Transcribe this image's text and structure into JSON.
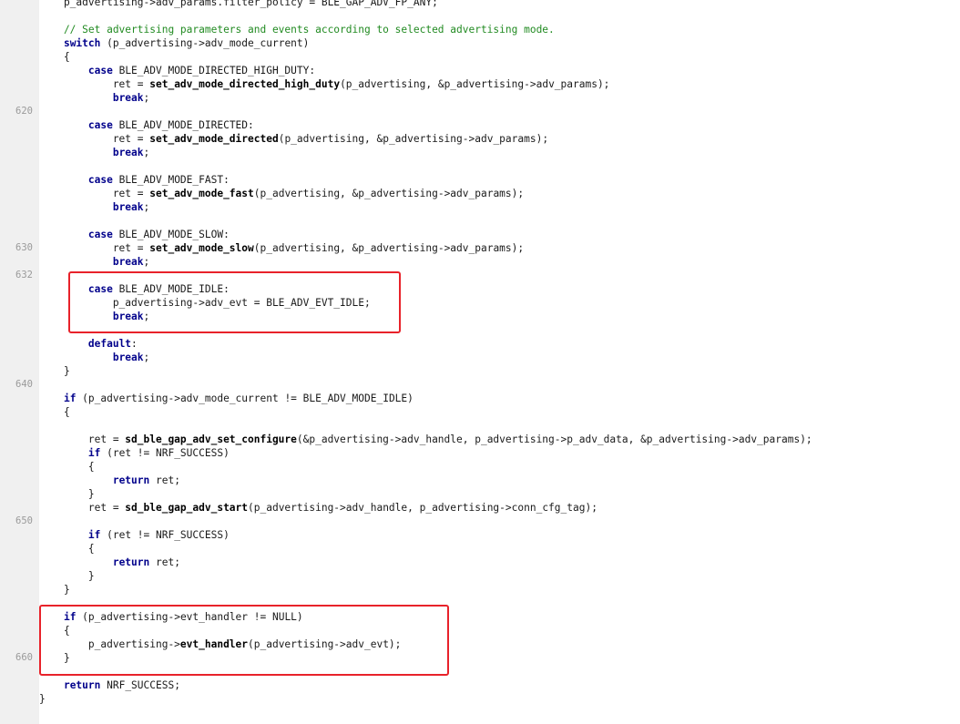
{
  "highlight_color": "#e8222a",
  "colors": {
    "keyword": "#00008b",
    "comment": "#228b22",
    "line_number": "#9a9a9a",
    "gutter": "#f0f0f0"
  },
  "line_numbers": [
    {
      "label": "620",
      "row": 8
    },
    {
      "label": "630",
      "row": 18
    },
    {
      "label": "632",
      "row": 20
    },
    {
      "label": "640",
      "row": 28
    },
    {
      "label": "650",
      "row": 38
    },
    {
      "label": "660",
      "row": 48
    }
  ],
  "lines": [
    [
      {
        "t": "    p_advertising->adv_params.filter_policy = BLE_GAP_ADV_FP_ANY;",
        "k": "tx"
      }
    ],
    [],
    [
      {
        "t": "    // Set advertising parameters and events according to selected advertising mode.",
        "k": "cm"
      }
    ],
    [
      {
        "t": "    ",
        "k": "tx"
      },
      {
        "t": "switch",
        "k": "kw"
      },
      {
        "t": " (p_advertising->adv_mode_current)",
        "k": "tx"
      }
    ],
    [
      {
        "t": "    {",
        "k": "tx"
      }
    ],
    [
      {
        "t": "        ",
        "k": "tx"
      },
      {
        "t": "case",
        "k": "kw"
      },
      {
        "t": " BLE_ADV_MODE_DIRECTED_HIGH_DUTY:",
        "k": "tx"
      }
    ],
    [
      {
        "t": "            ret = ",
        "k": "tx"
      },
      {
        "t": "set_adv_mode_directed_high_duty",
        "k": "fn"
      },
      {
        "t": "(p_advertising, &p_advertising->adv_params);",
        "k": "tx"
      }
    ],
    [
      {
        "t": "            ",
        "k": "tx"
      },
      {
        "t": "break",
        "k": "kw"
      },
      {
        "t": ";",
        "k": "tx"
      }
    ],
    [],
    [
      {
        "t": "        ",
        "k": "tx"
      },
      {
        "t": "case",
        "k": "kw"
      },
      {
        "t": " BLE_ADV_MODE_DIRECTED:",
        "k": "tx"
      }
    ],
    [
      {
        "t": "            ret = ",
        "k": "tx"
      },
      {
        "t": "set_adv_mode_directed",
        "k": "fn"
      },
      {
        "t": "(p_advertising, &p_advertising->adv_params);",
        "k": "tx"
      }
    ],
    [
      {
        "t": "            ",
        "k": "tx"
      },
      {
        "t": "break",
        "k": "kw"
      },
      {
        "t": ";",
        "k": "tx"
      }
    ],
    [],
    [
      {
        "t": "        ",
        "k": "tx"
      },
      {
        "t": "case",
        "k": "kw"
      },
      {
        "t": " BLE_ADV_MODE_FAST:",
        "k": "tx"
      }
    ],
    [
      {
        "t": "            ret = ",
        "k": "tx"
      },
      {
        "t": "set_adv_mode_fast",
        "k": "fn"
      },
      {
        "t": "(p_advertising, &p_advertising->adv_params);",
        "k": "tx"
      }
    ],
    [
      {
        "t": "            ",
        "k": "tx"
      },
      {
        "t": "break",
        "k": "kw"
      },
      {
        "t": ";",
        "k": "tx"
      }
    ],
    [],
    [
      {
        "t": "        ",
        "k": "tx"
      },
      {
        "t": "case",
        "k": "kw"
      },
      {
        "t": " BLE_ADV_MODE_SLOW:",
        "k": "tx"
      }
    ],
    [
      {
        "t": "            ret = ",
        "k": "tx"
      },
      {
        "t": "set_adv_mode_slow",
        "k": "fn"
      },
      {
        "t": "(p_advertising, &p_advertising->adv_params);",
        "k": "tx"
      }
    ],
    [
      {
        "t": "            ",
        "k": "tx"
      },
      {
        "t": "break",
        "k": "kw"
      },
      {
        "t": ";",
        "k": "tx"
      }
    ],
    [],
    [
      {
        "t": "        ",
        "k": "tx"
      },
      {
        "t": "case",
        "k": "kw"
      },
      {
        "t": " BLE_ADV_MODE_IDLE:",
        "k": "tx"
      }
    ],
    [
      {
        "t": "            p_advertising->adv_evt = BLE_ADV_EVT_IDLE;",
        "k": "tx"
      }
    ],
    [
      {
        "t": "            ",
        "k": "tx"
      },
      {
        "t": "break",
        "k": "kw"
      },
      {
        "t": ";",
        "k": "tx"
      }
    ],
    [],
    [
      {
        "t": "        ",
        "k": "tx"
      },
      {
        "t": "default",
        "k": "kw"
      },
      {
        "t": ":",
        "k": "tx"
      }
    ],
    [
      {
        "t": "            ",
        "k": "tx"
      },
      {
        "t": "break",
        "k": "kw"
      },
      {
        "t": ";",
        "k": "tx"
      }
    ],
    [
      {
        "t": "    }",
        "k": "tx"
      }
    ],
    [],
    [
      {
        "t": "    ",
        "k": "tx"
      },
      {
        "t": "if",
        "k": "kw"
      },
      {
        "t": " (p_advertising->adv_mode_current != BLE_ADV_MODE_IDLE)",
        "k": "tx"
      }
    ],
    [
      {
        "t": "    {",
        "k": "tx"
      }
    ],
    [],
    [
      {
        "t": "        ret = ",
        "k": "tx"
      },
      {
        "t": "sd_ble_gap_adv_set_configure",
        "k": "fn"
      },
      {
        "t": "(&p_advertising->adv_handle, p_advertising->p_adv_data, &p_advertising->adv_params);",
        "k": "tx"
      }
    ],
    [
      {
        "t": "        ",
        "k": "tx"
      },
      {
        "t": "if",
        "k": "kw"
      },
      {
        "t": " (ret != NRF_SUCCESS)",
        "k": "tx"
      }
    ],
    [
      {
        "t": "        {",
        "k": "tx"
      }
    ],
    [
      {
        "t": "            ",
        "k": "tx"
      },
      {
        "t": "return",
        "k": "kw"
      },
      {
        "t": " ret;",
        "k": "tx"
      }
    ],
    [
      {
        "t": "        }",
        "k": "tx"
      }
    ],
    [
      {
        "t": "        ret = ",
        "k": "tx"
      },
      {
        "t": "sd_ble_gap_adv_start",
        "k": "fn"
      },
      {
        "t": "(p_advertising->adv_handle, p_advertising->conn_cfg_tag);",
        "k": "tx"
      }
    ],
    [],
    [
      {
        "t": "        ",
        "k": "tx"
      },
      {
        "t": "if",
        "k": "kw"
      },
      {
        "t": " (ret != NRF_SUCCESS)",
        "k": "tx"
      }
    ],
    [
      {
        "t": "        {",
        "k": "tx"
      }
    ],
    [
      {
        "t": "            ",
        "k": "tx"
      },
      {
        "t": "return",
        "k": "kw"
      },
      {
        "t": " ret;",
        "k": "tx"
      }
    ],
    [
      {
        "t": "        }",
        "k": "tx"
      }
    ],
    [
      {
        "t": "    }",
        "k": "tx"
      }
    ],
    [],
    [
      {
        "t": "    ",
        "k": "tx"
      },
      {
        "t": "if",
        "k": "kw"
      },
      {
        "t": " (p_advertising->evt_handler != NULL)",
        "k": "tx"
      }
    ],
    [
      {
        "t": "    {",
        "k": "tx"
      }
    ],
    [
      {
        "t": "        p_advertising->",
        "k": "tx"
      },
      {
        "t": "evt_handler",
        "k": "fn"
      },
      {
        "t": "(p_advertising->adv_evt);",
        "k": "tx"
      }
    ],
    [
      {
        "t": "    }",
        "k": "tx"
      }
    ],
    [],
    [
      {
        "t": "    ",
        "k": "tx"
      },
      {
        "t": "return",
        "k": "kw"
      },
      {
        "t": " NRF_SUCCESS;",
        "k": "tx"
      }
    ],
    [
      {
        "t": "}",
        "k": "tx"
      }
    ]
  ]
}
